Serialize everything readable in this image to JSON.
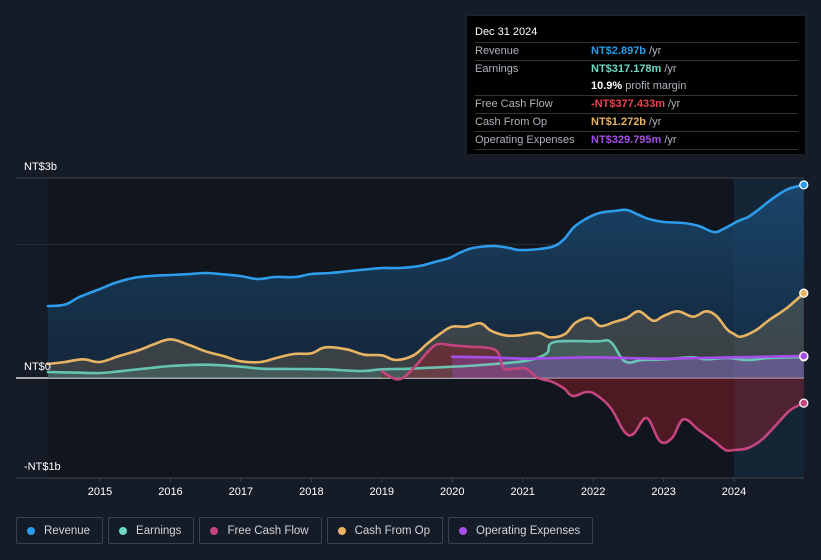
{
  "tooltip": {
    "date": "Dec 31 2024",
    "rows": [
      {
        "label": "Revenue",
        "value": "NT$2.897b",
        "unit": "/yr",
        "color": "#2d9cea"
      },
      {
        "label": "Earnings",
        "value": "NT$317.178m",
        "unit": "/yr",
        "color": "#6dd9c3"
      },
      {
        "label": "",
        "value": "10.9%",
        "unit": "profit margin",
        "color": "#ffffff"
      },
      {
        "label": "Free Cash Flow",
        "value": "-NT$377.433m",
        "unit": "/yr",
        "color": "#e8434e"
      },
      {
        "label": "Cash From Op",
        "value": "NT$1.272b",
        "unit": "/yr",
        "color": "#e8b463"
      },
      {
        "label": "Operating Expenses",
        "value": "NT$329.795m",
        "unit": "/yr",
        "color": "#a64ee8"
      }
    ]
  },
  "legend": [
    {
      "label": "Revenue",
      "color": "#2d9cea"
    },
    {
      "label": "Earnings",
      "color": "#6dd9c3"
    },
    {
      "label": "Free Cash Flow",
      "color": "#c4457e"
    },
    {
      "label": "Cash From Op",
      "color": "#e8b463"
    },
    {
      "label": "Operating Expenses",
      "color": "#a64ee8"
    }
  ],
  "chart_data": {
    "type": "area",
    "title": "",
    "xlabel": "",
    "ylabel": "",
    "units": "NT$ billions",
    "xlim": [
      2014.26,
      2024.99
    ],
    "ylim": [
      -1.5,
      3
    ],
    "y_tick_labels": [
      {
        "value": 3,
        "label": "NT$3b"
      },
      {
        "value": 0,
        "label": "NT$0"
      },
      {
        "value": -1,
        "label": "-NT$1b"
      }
    ],
    "x_tick_labels": [
      "2015",
      "2016",
      "2017",
      "2018",
      "2019",
      "2020",
      "2021",
      "2022",
      "2023",
      "2024"
    ],
    "x_ticks": [
      2015,
      2016,
      2017,
      2018,
      2019,
      2020,
      2021,
      2022,
      2023,
      2024
    ],
    "highlight_from": 2024.0,
    "grid": true,
    "legend_position": "bottom",
    "series": [
      {
        "name": "Revenue",
        "color": "#2d9cea",
        "x": [
          2014.26,
          2014.5,
          2014.71,
          2015.0,
          2015.21,
          2015.47,
          2015.71,
          2016.0,
          2016.28,
          2016.5,
          2016.7,
          2016.99,
          2017.24,
          2017.48,
          2017.77,
          2018.0,
          2018.26,
          2018.55,
          2018.83,
          2019.01,
          2019.25,
          2019.53,
          2019.75,
          2019.96,
          2020.1,
          2020.24,
          2020.38,
          2020.6,
          2020.81,
          2020.95,
          2021.24,
          2021.45,
          2021.59,
          2021.73,
          2021.92,
          2022.09,
          2022.3,
          2022.48,
          2022.65,
          2022.79,
          2023.0,
          2023.28,
          2023.5,
          2023.71,
          2023.85,
          2024.06,
          2024.2,
          2024.34,
          2024.56,
          2024.77,
          2024.99
        ],
        "values": [
          1.08,
          1.1,
          1.215,
          1.335,
          1.425,
          1.5,
          1.53,
          1.545,
          1.56,
          1.575,
          1.56,
          1.53,
          1.485,
          1.515,
          1.515,
          1.56,
          1.575,
          1.605,
          1.635,
          1.65,
          1.65,
          1.68,
          1.74,
          1.8,
          1.875,
          1.935,
          1.965,
          1.98,
          1.95,
          1.92,
          1.935,
          1.98,
          2.085,
          2.265,
          2.4,
          2.475,
          2.505,
          2.52,
          2.445,
          2.385,
          2.34,
          2.325,
          2.28,
          2.19,
          2.235,
          2.355,
          2.415,
          2.52,
          2.7,
          2.835,
          2.897
        ]
      },
      {
        "name": "Earnings",
        "color": "#6dd9c3",
        "x": [
          2014.26,
          2014.71,
          2015.0,
          2015.27,
          2015.71,
          2016.0,
          2016.5,
          2017.0,
          2017.3,
          2017.8,
          2018.2,
          2018.7,
          2019.0,
          2019.4,
          2019.8,
          2020.2,
          2020.6,
          2021.0,
          2021.2,
          2021.35,
          2021.45,
          2022.05,
          2022.25,
          2022.45,
          2022.7,
          2023.0,
          2023.4,
          2023.6,
          2023.9,
          2024.2,
          2024.5,
          2024.99
        ],
        "values": [
          0.09,
          0.08,
          0.075,
          0.1,
          0.15,
          0.18,
          0.2,
          0.17,
          0.14,
          0.135,
          0.13,
          0.105,
          0.13,
          0.14,
          0.16,
          0.18,
          0.21,
          0.25,
          0.3,
          0.38,
          0.54,
          0.55,
          0.54,
          0.25,
          0.27,
          0.28,
          0.31,
          0.28,
          0.3,
          0.27,
          0.3,
          0.317
        ]
      },
      {
        "name": "Free Cash Flow",
        "color": "#c4457e",
        "x": [
          2019.0,
          2019.24,
          2019.45,
          2019.66,
          2019.8,
          2020.0,
          2020.25,
          2020.52,
          2020.65,
          2020.73,
          2020.9,
          2021.05,
          2021.22,
          2021.4,
          2021.58,
          2021.71,
          2021.9,
          2022.04,
          2022.25,
          2022.44,
          2022.57,
          2022.76,
          2022.95,
          2023.12,
          2023.28,
          2023.5,
          2023.72,
          2023.88,
          2024.0,
          2024.2,
          2024.4,
          2024.6,
          2024.8,
          2024.99
        ],
        "values": [
          0.1,
          -0.02,
          0.15,
          0.4,
          0.51,
          0.49,
          0.47,
          0.45,
          0.38,
          0.15,
          0.14,
          0.14,
          0.0,
          -0.05,
          -0.15,
          -0.27,
          -0.21,
          -0.25,
          -0.45,
          -0.8,
          -0.84,
          -0.6,
          -0.95,
          -0.9,
          -0.62,
          -0.78,
          -0.95,
          -1.08,
          -1.08,
          -1.05,
          -0.92,
          -0.7,
          -0.48,
          -0.377
        ]
      },
      {
        "name": "Cash From Op",
        "color": "#e8b463",
        "x": [
          2014.26,
          2014.5,
          2014.76,
          2015.0,
          2015.27,
          2015.56,
          2015.75,
          2016.0,
          2016.25,
          2016.5,
          2016.75,
          2017.0,
          2017.28,
          2017.5,
          2017.75,
          2018.0,
          2018.2,
          2018.5,
          2018.75,
          2019.0,
          2019.2,
          2019.45,
          2019.65,
          2019.85,
          2020.0,
          2020.2,
          2020.4,
          2020.55,
          2020.75,
          2020.95,
          2021.22,
          2021.39,
          2021.6,
          2021.75,
          2021.95,
          2022.1,
          2022.3,
          2022.48,
          2022.65,
          2022.85,
          2023.0,
          2023.2,
          2023.42,
          2023.6,
          2023.75,
          2023.9,
          2024.0,
          2024.1,
          2024.3,
          2024.5,
          2024.75,
          2024.99
        ],
        "values": [
          0.21,
          0.24,
          0.28,
          0.24,
          0.33,
          0.42,
          0.5,
          0.58,
          0.5,
          0.4,
          0.33,
          0.25,
          0.24,
          0.3,
          0.36,
          0.37,
          0.46,
          0.43,
          0.35,
          0.34,
          0.27,
          0.34,
          0.52,
          0.68,
          0.77,
          0.77,
          0.82,
          0.71,
          0.64,
          0.64,
          0.68,
          0.61,
          0.66,
          0.83,
          0.9,
          0.78,
          0.84,
          0.9,
          1.0,
          0.86,
          0.93,
          1.0,
          0.92,
          1.0,
          0.93,
          0.73,
          0.66,
          0.62,
          0.71,
          0.87,
          1.05,
          1.272
        ]
      },
      {
        "name": "Operating Expenses",
        "color": "#a64ee8",
        "x": [
          2020.0,
          2020.5,
          2021.0,
          2021.5,
          2022.0,
          2022.5,
          2023.0,
          2023.5,
          2024.0,
          2024.5,
          2024.99
        ],
        "values": [
          0.32,
          0.31,
          0.29,
          0.3,
          0.31,
          0.3,
          0.29,
          0.3,
          0.31,
          0.32,
          0.33
        ]
      }
    ]
  }
}
